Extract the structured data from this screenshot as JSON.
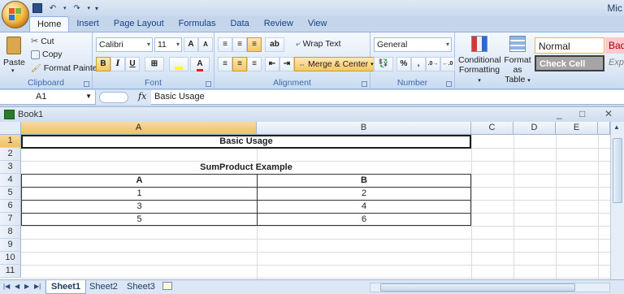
{
  "app": {
    "title_fragment": "Mic"
  },
  "quick_access": {
    "save": "save-icon",
    "undo": "undo-icon",
    "redo": "redo-icon"
  },
  "tabs": [
    "Home",
    "Insert",
    "Page Layout",
    "Formulas",
    "Data",
    "Review",
    "View"
  ],
  "ribbon": {
    "clipboard": {
      "label": "Clipboard",
      "paste": "Paste",
      "cut": "Cut",
      "copy": "Copy",
      "format_painter": "Format Painter"
    },
    "font": {
      "label": "Font",
      "family": "Calibri",
      "size": "11",
      "grow": "A",
      "shrink": "A",
      "bold": "B",
      "italic": "I",
      "underline": "U",
      "font_color_letter": "A"
    },
    "alignment": {
      "label": "Alignment",
      "wrap_text": "Wrap Text",
      "merge_center": "Merge & Center"
    },
    "number": {
      "label": "Number",
      "format": "General",
      "percent": "%",
      "comma": ","
    },
    "styles": {
      "conditional_formatting_line1": "Conditional",
      "conditional_formatting_line2": "Formatting",
      "format_table_line1": "Format as",
      "format_table_line2": "Table",
      "normal": "Normal",
      "bad": "Bad",
      "check_cell": "Check Cell",
      "explanatory": "Expl"
    }
  },
  "formula_bar": {
    "name_box": "A1",
    "fx": "fx",
    "content": "Basic Usage"
  },
  "workbook": {
    "title": "Book1",
    "minimize": "_",
    "restore": "□",
    "close": "✕"
  },
  "grid": {
    "columns": [
      "A",
      "B",
      "C",
      "D",
      "E"
    ],
    "rows": [
      "1",
      "2",
      "3",
      "4",
      "5",
      "6",
      "7",
      "8",
      "9",
      "10",
      "11"
    ],
    "cells": {
      "r1_title": "Basic Usage",
      "r3_title": "SumProduct Example",
      "r4_a": "A",
      "r4_b": "B",
      "r5_a": "1",
      "r5_b": "2",
      "r6_a": "3",
      "r6_b": "4",
      "r7_a": "5",
      "r7_b": "6"
    }
  },
  "sheets": {
    "tabs": [
      "Sheet1",
      "Sheet2",
      "Sheet3"
    ],
    "active": "Sheet1"
  },
  "colors": {
    "accent": "#f1c15f",
    "ribbon": "#dbe7f5",
    "header_border": "#9eb6ce"
  }
}
